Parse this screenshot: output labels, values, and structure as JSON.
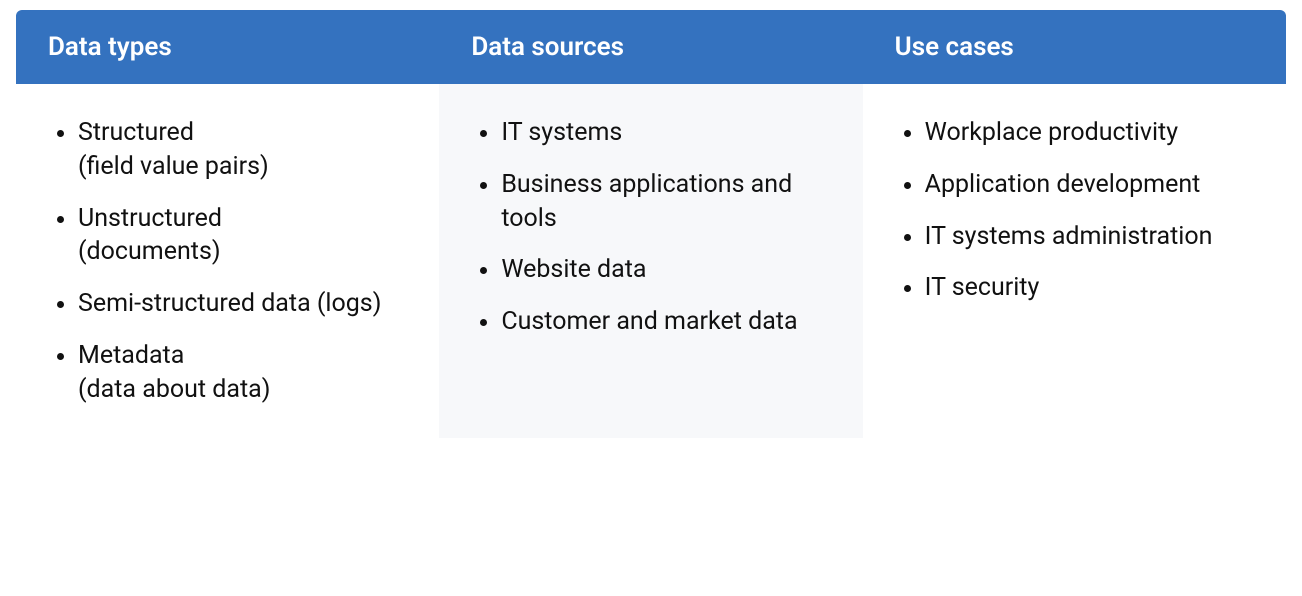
{
  "columns": [
    {
      "header": "Data types",
      "shaded": false,
      "items": [
        {
          "text": "Structured",
          "paren": "(field value pairs)"
        },
        {
          "text": "Unstructured",
          "paren": "(documents)"
        },
        {
          "text": "Semi-structured data (logs)"
        },
        {
          "text": "Metadata",
          "paren": "(data about data)"
        }
      ]
    },
    {
      "header": "Data sources",
      "shaded": true,
      "items": [
        {
          "text": "IT systems"
        },
        {
          "text": "Business applications and tools"
        },
        {
          "text": "Website data"
        },
        {
          "text": "Customer and market data"
        }
      ]
    },
    {
      "header": "Use cases",
      "shaded": false,
      "items": [
        {
          "text": "Workplace productivity"
        },
        {
          "text": "Application development"
        },
        {
          "text": "IT systems administration"
        },
        {
          "text": "IT security"
        }
      ]
    }
  ]
}
